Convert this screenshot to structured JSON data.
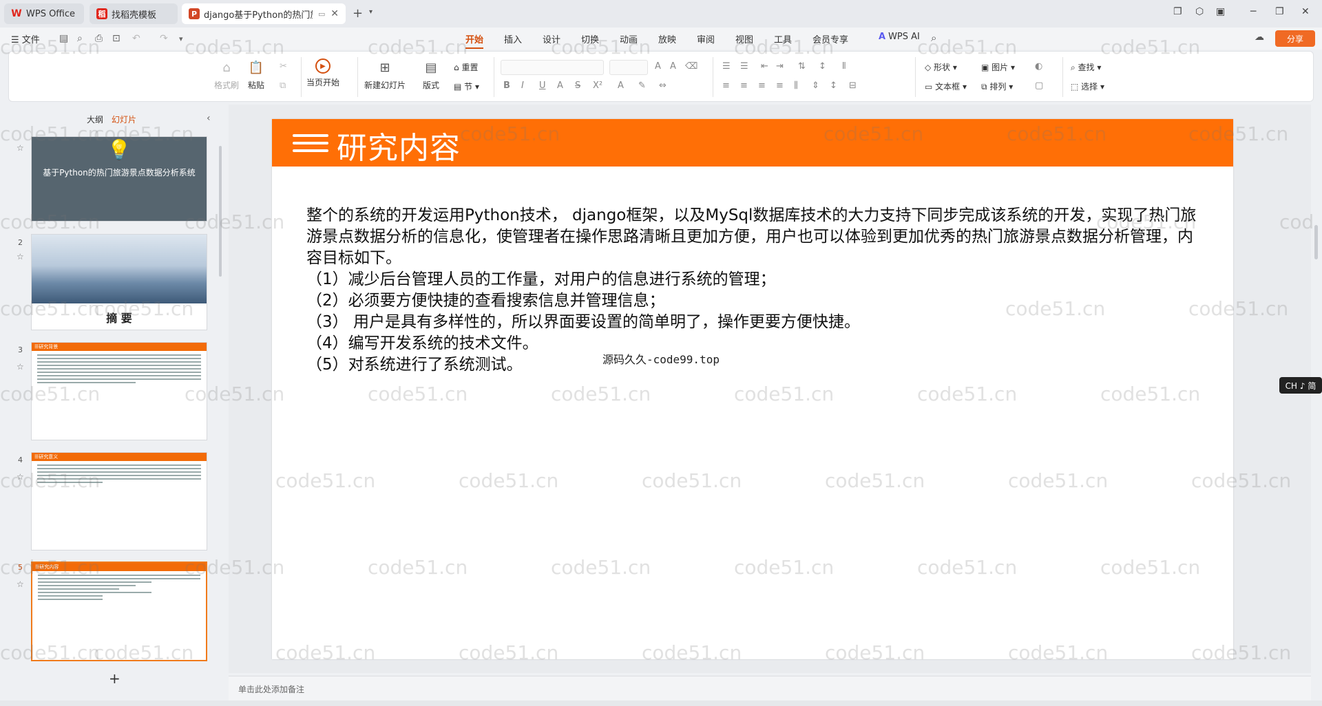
{
  "tabs": [
    {
      "label": "WPS Office",
      "icon": "wps-logo-icon",
      "color": "#e0261c"
    },
    {
      "label": "找稻壳模板",
      "icon": "docer-icon",
      "color": "#e0261c"
    },
    {
      "label": "django基于Python的热门旅",
      "icon": "ppt-icon",
      "color": "#d24726"
    }
  ],
  "menu": {
    "file": "☰ 文件",
    "tabs": [
      "开始",
      "插入",
      "设计",
      "切换",
      "动画",
      "放映",
      "审阅",
      "视图",
      "工具",
      "会员专享"
    ],
    "active_tab": "开始",
    "wps_ai": "WPS AI",
    "share": "分享"
  },
  "ribbon": {
    "format_painter": "格式刷",
    "paste": "粘贴",
    "start_from_current": "当页开始",
    "new_slide": "新建幻灯片",
    "layout": "版式",
    "reset": "重置",
    "section": "节",
    "shape": "形状",
    "picture": "图片",
    "textbox": "文本框",
    "arrange": "排列",
    "find": "查找",
    "select": "选择"
  },
  "left_panel": {
    "tab_outline": "大纲",
    "tab_slides": "幻灯片",
    "slides": [
      {
        "num": "",
        "title": "基于Python的热门旅游景点数据分析系统"
      },
      {
        "num": "2",
        "title": "摘  要"
      },
      {
        "num": "3",
        "title": "研究背景"
      },
      {
        "num": "4",
        "title": "研究意义"
      },
      {
        "num": "5",
        "title": "研究内容"
      }
    ],
    "add_slide": "+"
  },
  "slide": {
    "title": "研究内容",
    "paragraph": "整个的系统的开发运用Python技术， django框架，以及MySql数据库技术的大力支持下同步完成该系统的开发，实现了热门旅游景点数据分析的信息化，使管理者在操作思路清晰且更加方便，用户也可以体验到更加优秀的热门旅游景点数据分析管理，内容目标如下。",
    "items": [
      "（1）减少后台管理人员的工作量，对用户的信息进行系统的管理；",
      "（2）必须要方便快捷的查看搜索信息并管理信息；",
      "（3） 用户是具有多样性的，所以界面要设置的简单明了，操作更要方便快捷。",
      "（4）编写开发系统的技术文件。",
      "（5）对系统进行了系统测试。"
    ],
    "source_note": "源码久久-code99.top",
    "header_color": "#ff6f06"
  },
  "notes_placeholder": "单击此处添加备注",
  "ime": "CH ♪ 简",
  "watermark": "code51.cn"
}
